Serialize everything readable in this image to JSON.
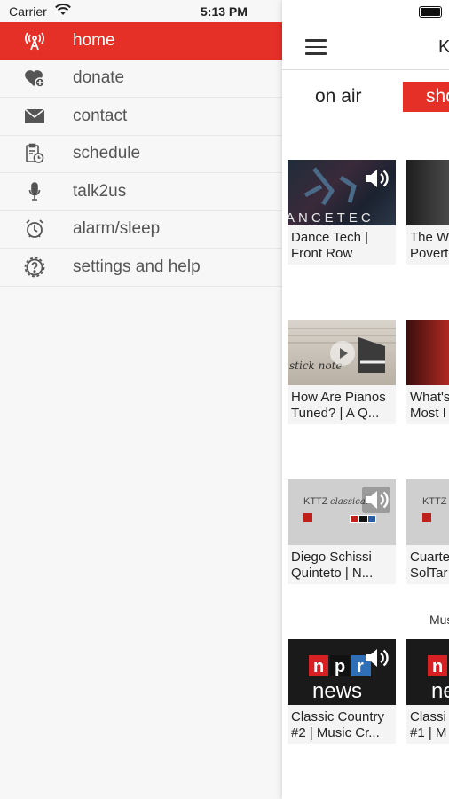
{
  "status_bar": {
    "carrier": "Carrier",
    "time": "5:13 PM"
  },
  "menu": {
    "items": [
      {
        "label": "home",
        "icon": "radio-tower-icon",
        "active": true
      },
      {
        "label": "donate",
        "icon": "heart-plus-icon",
        "active": false
      },
      {
        "label": "contact",
        "icon": "envelope-icon",
        "active": false
      },
      {
        "label": "schedule",
        "icon": "clipboard-clock-icon",
        "active": false
      },
      {
        "label": "talk2us",
        "icon": "microphone-icon",
        "active": false
      },
      {
        "label": "alarm/sleep",
        "icon": "alarm-clock-icon",
        "active": false
      },
      {
        "label": "settings and help",
        "icon": "gear-question-icon",
        "active": false
      }
    ],
    "active_color": "#e53027"
  },
  "header": {
    "title": "K"
  },
  "tabs": {
    "on_air": "on air",
    "shows": "sho"
  },
  "section_label": "Mus",
  "cards": [
    {
      "title": "Dance Tech |\nFront Row",
      "thumb": "dance-tech-thumbnail",
      "speaker": true
    },
    {
      "title": "The W\nPovert",
      "thumb": "lecture-thumbnail",
      "speaker": false
    },
    {
      "title": "How Are Pianos\nTuned? | A Q...",
      "thumb": "piano-thumbnail",
      "play": true
    },
    {
      "title": "What's\nMost I",
      "thumb": "presenter-thumbnail",
      "speaker": false
    },
    {
      "title": "Diego Schissi\nQuinteto | N...",
      "thumb": "kttz-classical-thumbnail",
      "thumb_text": "KTTZ",
      "speaker": true
    },
    {
      "title": "Cuarte\nSolTar",
      "thumb": "kttz-classical-thumbnail",
      "thumb_text": "KTTZ",
      "speaker": false
    },
    {
      "title": "Classic Country\n#2 | Music Cr...",
      "thumb": "npr-news-thumbnail",
      "thumb_text": "news",
      "speaker": true
    },
    {
      "title": "Classi\n#1 | M",
      "thumb": "npr-news-thumbnail",
      "thumb_text": "ne",
      "speaker": false
    }
  ]
}
